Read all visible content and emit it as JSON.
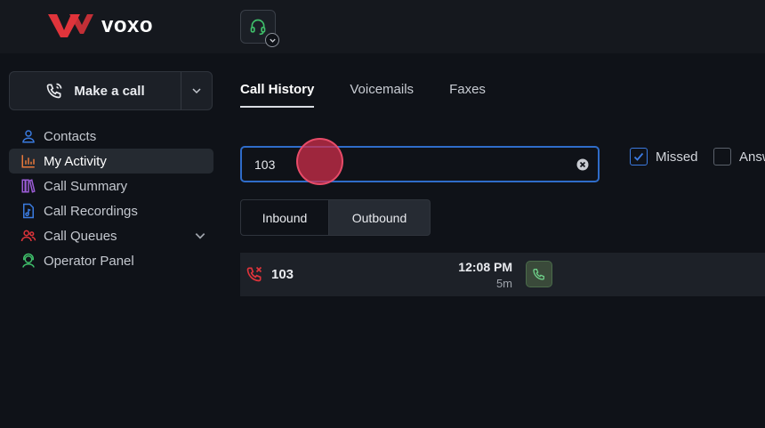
{
  "header": {
    "brand": "voxo",
    "status_icon": "headset-icon",
    "brand_color": "#e0343b"
  },
  "make_call": {
    "label": "Make a call",
    "icon": "phone-icon"
  },
  "sidebar": {
    "items": [
      {
        "label": "Contacts",
        "icon": "person-icon",
        "color": "#3a7be0",
        "active": false
      },
      {
        "label": "My Activity",
        "icon": "bar-chart-icon",
        "color": "#e8783a",
        "active": true
      },
      {
        "label": "Call Summary",
        "icon": "books-icon",
        "color": "#9b5cd6",
        "active": false
      },
      {
        "label": "Call Recordings",
        "icon": "audio-file-icon",
        "color": "#3a7be0",
        "active": false
      },
      {
        "label": "Call Queues",
        "icon": "people-icon",
        "color": "#e0343b",
        "active": false
      },
      {
        "label": "Operator Panel",
        "icon": "operator-icon",
        "color": "#3fbf6a",
        "active": false
      }
    ]
  },
  "tabs": [
    {
      "label": "Call History",
      "active": true
    },
    {
      "label": "Voicemails",
      "active": false
    },
    {
      "label": "Faxes",
      "active": false
    }
  ],
  "search": {
    "value": "103"
  },
  "filters": [
    {
      "label": "Missed",
      "checked": true
    },
    {
      "label": "Answ",
      "checked": false
    }
  ],
  "direction": {
    "inbound": "Inbound",
    "outbound": "Outbound"
  },
  "history": [
    {
      "number": "103",
      "time": "12:08 PM",
      "duration": "5m",
      "type": "missed"
    }
  ]
}
